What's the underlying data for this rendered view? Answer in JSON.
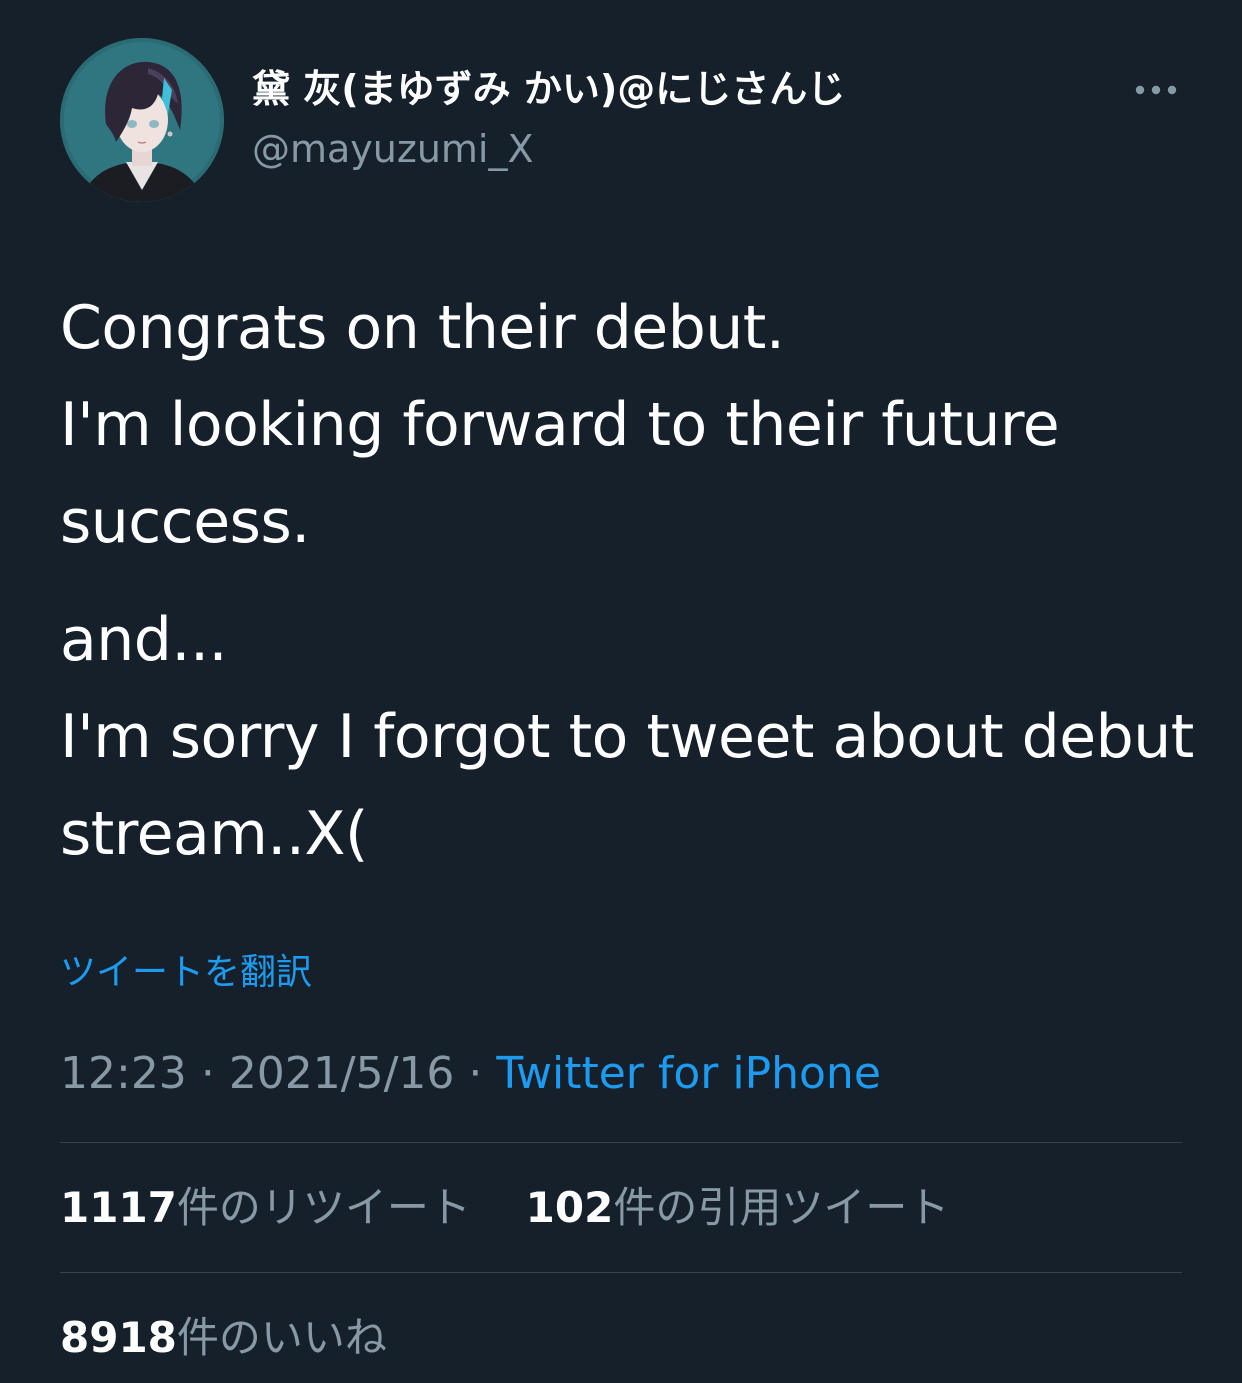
{
  "tweet": {
    "author": {
      "display_name": "黛 灰(まゆずみ かい)@にじさんじ",
      "handle": "@mayuzumi_X",
      "avatar_icon": "avatar-illustration"
    },
    "more_icon": "more-horizontal-icon",
    "text_paragraph_1": "Congrats on their debut.\nI'm looking forward to their future success.",
    "text_paragraph_2": "and...\nI'm sorry I forgot to tweet about debut stream..X(",
    "translate_label": "ツイートを翻訳",
    "time": "12:23",
    "separator": "·",
    "date": "2021/5/16",
    "source": "Twitter for iPhone",
    "stats": {
      "retweets_count": "1117",
      "retweets_label": "件のリツイート",
      "quotes_count": "102",
      "quotes_label": "件の引用ツイート",
      "likes_count": "8918",
      "likes_label": "件のいいね"
    }
  },
  "colors": {
    "background": "#15202b",
    "primary_text": "#ffffff",
    "secondary_text": "#8899a6",
    "accent": "#1d9bf0",
    "divider": "#38444d"
  }
}
